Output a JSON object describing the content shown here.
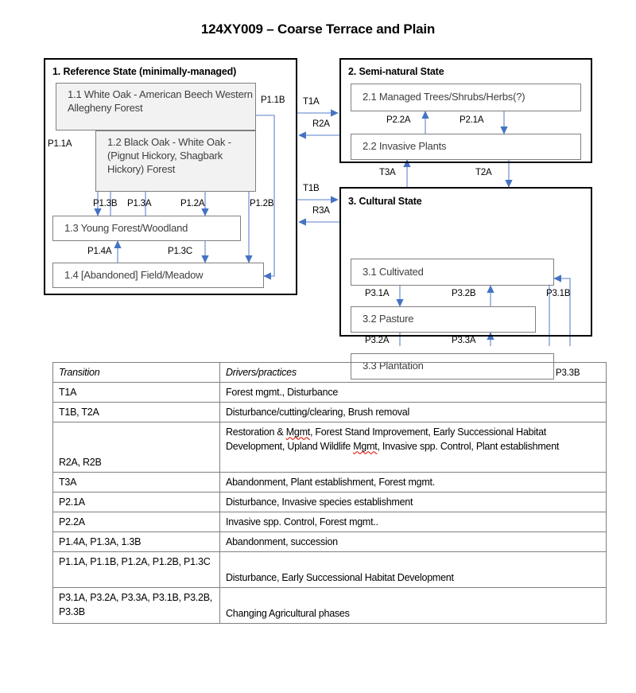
{
  "title": "124XY009 – Coarse Terrace and Plain",
  "colors": {
    "arrow_head": "#4472c4",
    "arrow_line": "#8faadc",
    "box_border": "#000000",
    "phase_border": "#808080",
    "phase_shaded_fill": "#f2f2f2",
    "spellcheck_underline": "#e03a2f"
  },
  "diagram": {
    "states": [
      {
        "id": "state-1",
        "title": "1.  Reference State (minimally-managed)",
        "phases": [
          {
            "id": "p1-1",
            "label": "1.1  White Oak - American Beech Western Allegheny Forest"
          },
          {
            "id": "p1-2",
            "label": "1.2  Black Oak - White Oak - (Pignut Hickory, Shagbark Hickory) Forest"
          },
          {
            "id": "p1-3",
            "label": "1.3  Young Forest/Woodland"
          },
          {
            "id": "p1-4",
            "label": "1.4  [Abandoned]  Field/Meadow"
          }
        ]
      },
      {
        "id": "state-2",
        "title": "2.  Semi-natural State",
        "phases": [
          {
            "id": "p2-1",
            "label": "2.1  Managed Trees/Shrubs/Herbs(?)"
          },
          {
            "id": "p2-2",
            "label": "2.2  Invasive Plants"
          }
        ]
      },
      {
        "id": "state-3",
        "title": "3.  Cultural State",
        "phases": [
          {
            "id": "p3-1",
            "label": "3.1  Cultivated"
          },
          {
            "id": "p3-2",
            "label": "3.2  Pasture"
          },
          {
            "id": "p3-3",
            "label": "3.3  Plantation"
          }
        ]
      }
    ],
    "arrow_labels": {
      "p1_1a": "P1.1A",
      "p1_1b": "P1.1B",
      "p1_2a": "P1.2A",
      "p1_2b": "P1.2B",
      "p1_3a": "P1.3A",
      "p1_3b": "P1.3B",
      "p1_3c": "P1.3C",
      "p1_4a": "P1.4A",
      "t1a": "T1A",
      "r2a": "R2A",
      "t1b": "T1B",
      "r3a": "R3A",
      "t3a": "T3A",
      "t2a": "T2A",
      "p2_1a": "P2.1A",
      "p2_2a": "P2.2A",
      "p3_1a": "P3.1A",
      "p3_1b": "P3.1B",
      "p3_2a": "P3.2A",
      "p3_2b": "P3.2B",
      "p3_3a": "P3.3A",
      "p3_3b": "P3.3B"
    }
  },
  "table": {
    "headers": {
      "transition": "Transition",
      "drivers": "Drivers/practices"
    },
    "rows": [
      {
        "transition": "T1A",
        "drivers": "Forest mgmt., Disturbance"
      },
      {
        "transition": "T1B, T2A",
        "drivers": "Disturbance/cutting/clearing, Brush removal"
      },
      {
        "transition": "R2A, R2B",
        "drivers": "Restoration & Mgmt, Forest Stand Improvement, Early Successional Habitat Development, Upland Wildlife Mgmt, Invasive spp. Control, Plant establishment"
      },
      {
        "transition": "T3A",
        "drivers": "Abandonment,  Plant establishment, Forest mgmt."
      },
      {
        "transition": "P2.1A",
        "drivers": "Disturbance, Invasive species establishment"
      },
      {
        "transition": "P2.2A",
        "drivers": "Invasive spp. Control, Forest mgmt.."
      },
      {
        "transition": "P1.4A, P1.3A, 1.3B",
        "drivers": "Abandonment,  succession"
      },
      {
        "transition": "P1.1A, P1.1B, P1.2A, P1.2B, P1.3C",
        "drivers": "Disturbance, Early Successional Habitat Development"
      },
      {
        "transition": "P3.1A, P3.2A, P3.3A, P3.1B, P3.2B, P3.3B",
        "drivers": "Changing Agricultural phases"
      }
    ]
  }
}
